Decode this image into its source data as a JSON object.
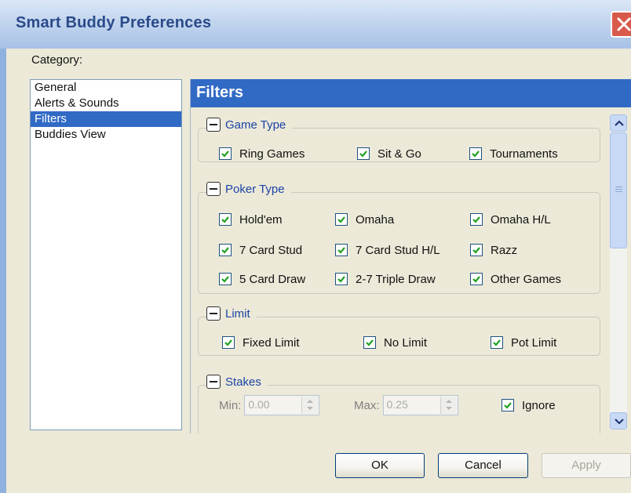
{
  "window": {
    "title": "Smart Buddy Preferences"
  },
  "category": {
    "label": "Category:",
    "items": [
      {
        "label": "General",
        "selected": false
      },
      {
        "label": "Alerts & Sounds",
        "selected": false
      },
      {
        "label": "Filters",
        "selected": true
      },
      {
        "label": "Buddies View",
        "selected": false
      }
    ]
  },
  "panel": {
    "title": "Filters",
    "groups": {
      "game_type": {
        "title": "Game Type",
        "options": [
          {
            "label": "Ring Games",
            "checked": true
          },
          {
            "label": "Sit & Go",
            "checked": true
          },
          {
            "label": "Tournaments",
            "checked": true
          }
        ]
      },
      "poker_type": {
        "title": "Poker Type",
        "options": [
          {
            "label": "Hold'em",
            "checked": true
          },
          {
            "label": "Omaha",
            "checked": true
          },
          {
            "label": "Omaha H/L",
            "checked": true
          },
          {
            "label": "7 Card Stud",
            "checked": true
          },
          {
            "label": "7 Card Stud H/L",
            "checked": true
          },
          {
            "label": "Razz",
            "checked": true
          },
          {
            "label": "5 Card Draw",
            "checked": true
          },
          {
            "label": "2-7 Triple Draw",
            "checked": true
          },
          {
            "label": "Other Games",
            "checked": true
          }
        ]
      },
      "limit": {
        "title": "Limit",
        "options": [
          {
            "label": "Fixed Limit",
            "checked": true
          },
          {
            "label": "No Limit",
            "checked": true
          },
          {
            "label": "Pot Limit",
            "checked": true
          }
        ]
      },
      "stakes": {
        "title": "Stakes",
        "min_label": "Min:",
        "min_value": "0.00",
        "max_label": "Max:",
        "max_value": "0.25",
        "ignore_label": "Ignore",
        "ignore_checked": true
      }
    }
  },
  "buttons": {
    "ok": "OK",
    "cancel": "Cancel",
    "apply": "Apply"
  },
  "icons": {
    "close": "close-icon",
    "collapse": "minus-icon",
    "check": "checkmark-icon",
    "scroll_up": "chevron-up-icon",
    "scroll_down": "chevron-down-icon"
  },
  "colors": {
    "selection": "#316ac5",
    "panel_header": "#316ac5",
    "group_title": "#1c44a6",
    "checkmark": "#21a121",
    "close_button": "#d85a4a"
  }
}
